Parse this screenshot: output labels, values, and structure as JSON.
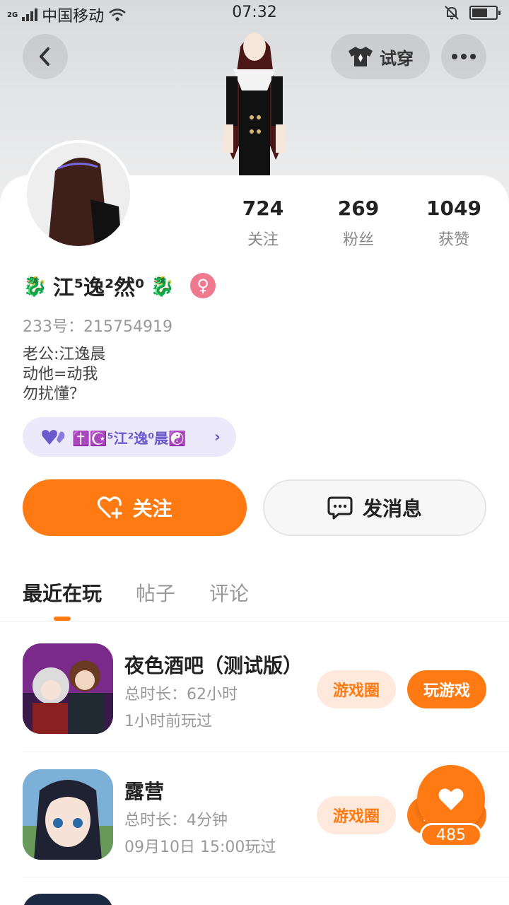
{
  "status_bar": {
    "network": "2G",
    "carrier": "中国移动",
    "time": "07:32"
  },
  "header": {
    "try_on_label": "试穿"
  },
  "profile": {
    "stats": [
      {
        "value": "724",
        "label": "关注"
      },
      {
        "value": "269",
        "label": "粉丝"
      },
      {
        "value": "1049",
        "label": "获赞"
      }
    ],
    "name": "江⁵逸²然⁰",
    "gender_symbol": "♀",
    "uid": "233号：215754919",
    "bio_lines": [
      "老公:江逸晨",
      "动他=动我",
      "勿扰懂？"
    ],
    "tag": "✝️☪️⁵江²逸⁰晨☯️"
  },
  "actions": {
    "follow_label": "关注",
    "message_label": "发消息"
  },
  "tabs": [
    {
      "label": "最近在玩",
      "active": true
    },
    {
      "label": "帖子",
      "active": false
    },
    {
      "label": "评论",
      "active": false
    }
  ],
  "games": [
    {
      "name": "夜色酒吧（测试版）",
      "duration": "总时长：62小时",
      "last_played": "1小时前玩过",
      "circle_label": "游戏圈",
      "play_label": "玩游戏"
    },
    {
      "name": "露营",
      "duration": "总时长：4分钟",
      "last_played": "09月10日 15:00玩过",
      "circle_label": "游戏圈",
      "play_label": "玩游戏"
    }
  ],
  "floating_like": {
    "count": "485"
  },
  "colors": {
    "accent": "#ff7a12",
    "tag_bg": "#ebe9fa",
    "tag_text": "#6a5acd",
    "gender_badge": "#f0788f"
  }
}
